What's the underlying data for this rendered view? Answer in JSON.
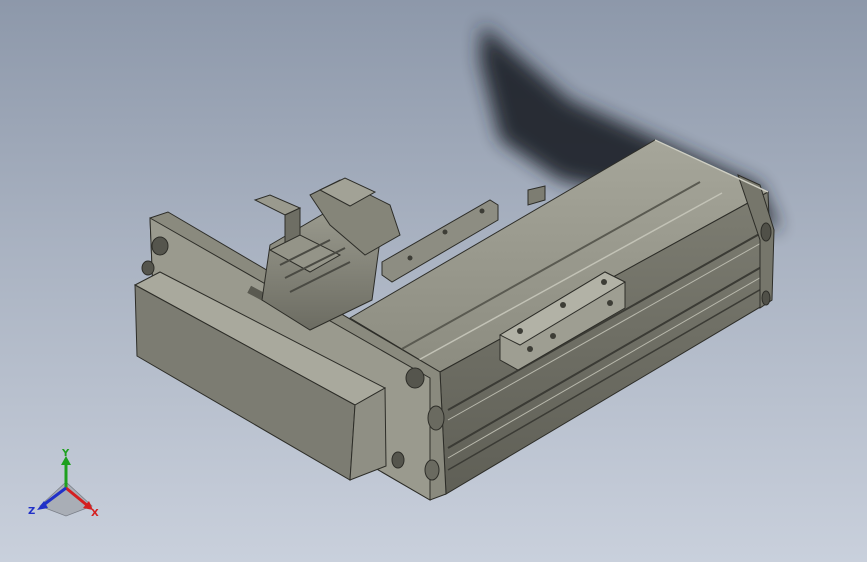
{
  "viewport": {
    "background_top": "#8d98aa",
    "background_bottom": "#c9d0dc"
  },
  "model": {
    "body_color": "#8e8e83",
    "shadow_color": "#23272e"
  },
  "triad": {
    "x_label": "X",
    "y_label": "Y",
    "z_label": "Z",
    "x_color": "#d42020",
    "y_color": "#1ea01e",
    "z_color": "#2030c8"
  }
}
